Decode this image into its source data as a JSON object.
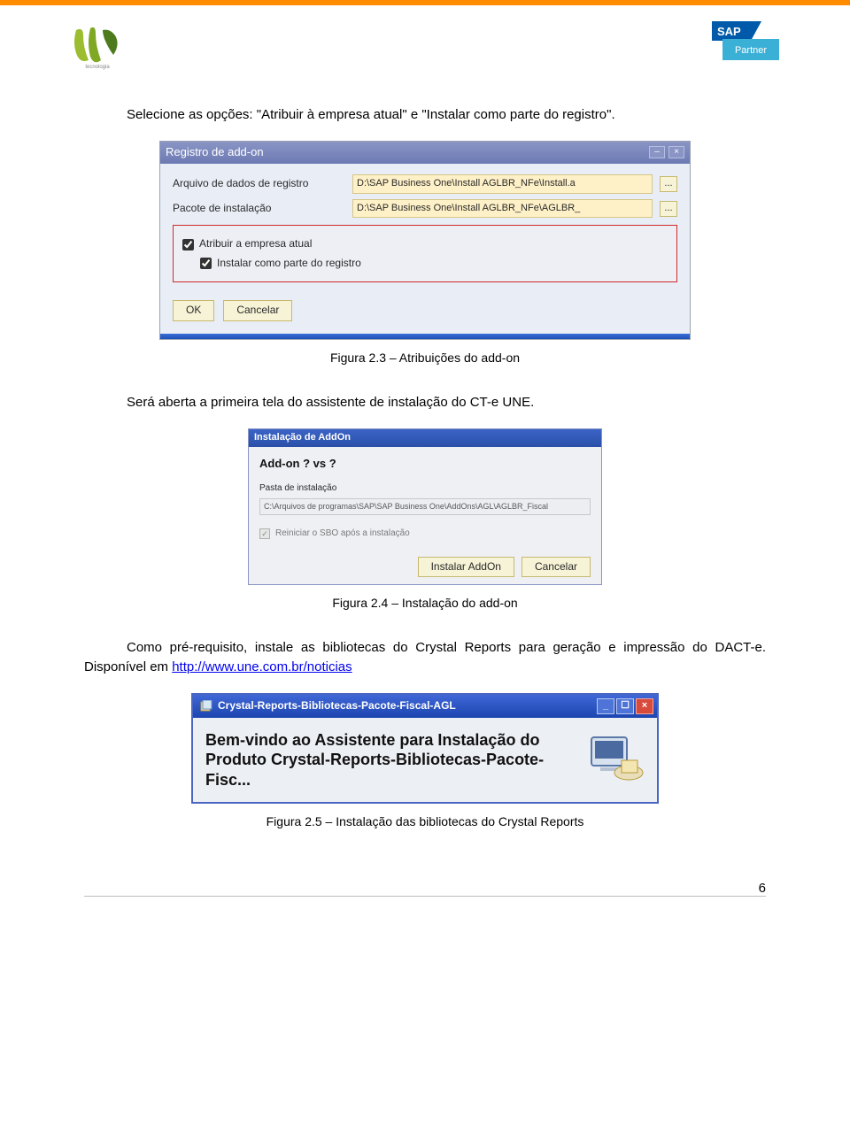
{
  "para1_prefix": "Selecione as opções: ",
  "para1_quote1": "\"Atribuir à empresa atual\"",
  "para1_mid": " e ",
  "para1_quote2": "\"Instalar como parte do registro\"",
  "para1_suffix": ".",
  "dialog1": {
    "title": "Registro de add-on",
    "row1_label": "Arquivo de dados de registro",
    "row1_value": "D:\\SAP Business One\\Install AGLBR_NFe\\Install.a",
    "row2_label": "Pacote de instalação",
    "row2_value": "D:\\SAP Business One\\Install AGLBR_NFe\\AGLBR_",
    "browse_label": "...",
    "chk1": "Atribuir a empresa atual",
    "chk2": "Instalar como parte do registro",
    "btn_ok": "OK",
    "btn_cancel": "Cancelar"
  },
  "caption1": "Figura 2.3 – Atribuições do add-on",
  "para2": "Será aberta a primeira tela do assistente de instalação do CT-e UNE.",
  "dialog2": {
    "title": "Instalação de AddOn",
    "header": "Add-on ? vs ?",
    "path_label": "Pasta de instalação",
    "path_value": "C:\\Arquivos de programas\\SAP\\SAP Business One\\AddOns\\AGL\\AGLBR_Fiscal",
    "chk_label": "Reiniciar o SBO após a instalação",
    "btn_install": "Instalar AddOn",
    "btn_cancel": "Cancelar"
  },
  "caption2": "Figura 2.4 – Instalação do add-on",
  "para3_prefix": "Como pré-requisito, instale as bibliotecas do Crystal Reports para geração e impressão do DACT-e. Disponível em ",
  "para3_link": "http://www.une.com.br/noticias",
  "dialog3": {
    "title": "Crystal-Reports-Bibliotecas-Pacote-Fiscal-AGL",
    "welcome_line1": "Bem-vindo ao Assistente para Instalação do",
    "welcome_line2": "Produto Crystal-Reports-Bibliotecas-Pacote-Fisc..."
  },
  "caption3": "Figura 2.5 – Instalação das bibliotecas do Crystal Reports",
  "page_number": "6"
}
